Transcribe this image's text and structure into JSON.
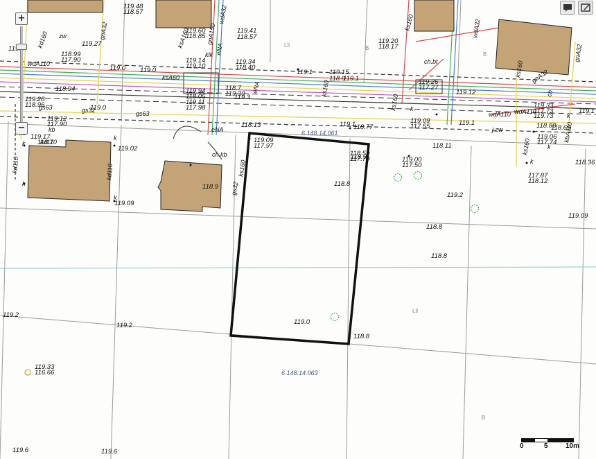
{
  "map": {
    "title": "",
    "zoom_control": {
      "zoom_in_label": "+",
      "zoom_out_label": "−"
    },
    "scale": {
      "ticks": [
        "0",
        "5",
        "10m"
      ]
    },
    "parcel_ids": [
      "6.148.14.063",
      "6.148.14.061"
    ],
    "land_class_labels": [
      "Lll",
      "B",
      "B",
      "Lll",
      "B"
    ],
    "elevation_labels": [
      "119.48",
      "118.57",
      "119.27",
      "119.41",
      "118.57",
      "119.60",
      "118.85",
      "118.99",
      "117.90",
      "119.20",
      "118.17",
      "119.34",
      "118.40",
      "119.0",
      "119.0",
      "119.14",
      "119.10",
      "119.1",
      "119.15",
      "118.0",
      "119.1",
      "119.26",
      "117.27",
      "119.12",
      "118.94",
      "119.28",
      "118.96",
      "119.94",
      "118.05",
      "119.11",
      "117.98",
      "118.7",
      "119.30",
      "119.0",
      "119.3",
      "119.33",
      "117.73",
      "119.12",
      "117.90",
      "119.17",
      "118.7",
      "119.09",
      "117.97",
      "119.09",
      "117.55",
      "118.13",
      "119.1",
      "119.1",
      "118.69",
      "119.06",
      "117.74",
      "118.11",
      "118.9",
      "119.00",
      "117.50",
      "118.36",
      "119.02",
      "119.09",
      "117.87",
      "118.12",
      "118.9",
      "118.8",
      "119.2",
      "118.8",
      "118.8",
      "119.09",
      "119.2",
      "119.2",
      "119.0",
      "118.8",
      "119.33",
      "116.66",
      "119.6",
      "119.6",
      "119.0",
      "119.1",
      "118.77",
      "118.88",
      "119.73",
      "118.59",
      "117.79"
    ],
    "utility_labels": [
      "zw",
      "kd160",
      "gnA32",
      "eNA",
      "wdA32",
      "gnA150",
      "ksA160",
      "klk",
      "wdA110",
      "eNA",
      "ksA60",
      "ch.bt",
      "ks160",
      "ks160",
      "wdA32",
      "ks160",
      "gs63",
      "kb",
      "gs32",
      "gs63",
      "ch.kb",
      "eNA",
      "ks160",
      "gs32",
      "kd110",
      "kb",
      "kd110",
      "kd110",
      "k",
      "k",
      "k",
      "k",
      "gnA32",
      "ch",
      "ks160",
      "wdA110",
      "j.zw",
      "k",
      "k",
      "ks160",
      "wdA110",
      "k",
      "k",
      "gnA32",
      "kbA110"
    ],
    "accent_colors": {
      "building": "#c4a477",
      "parcel_outline": "#111111",
      "utility_red": "#d94a4a",
      "utility_green": "#3fae5b",
      "utility_blue": "#4a7fd0",
      "utility_yellow": "#e8d24a",
      "utility_magenta": "#c25ac8",
      "tree": "#4caf50",
      "grid_cyan": "#7fc9c9"
    },
    "tools": {
      "comment_icon": "comment-icon",
      "edit_icon": "edit-icon"
    }
  }
}
